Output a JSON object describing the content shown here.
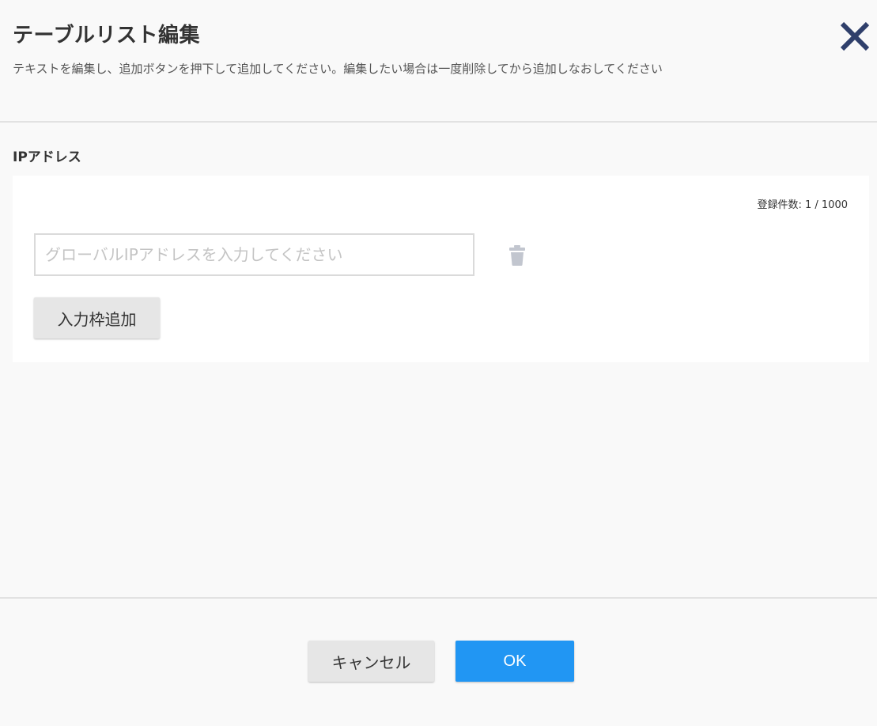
{
  "dialog": {
    "title": "テーブルリスト編集",
    "description": "テキストを編集し、追加ボタンを押下して追加してください。編集したい場合は一度削除してから追加しなおしてください",
    "close_icon": "close-icon"
  },
  "section": {
    "label": "IPアドレス",
    "count_label": "登録件数: ",
    "count_current": "1",
    "count_separator": " / ",
    "count_max": "1000",
    "entries": [
      {
        "value": "",
        "placeholder": "グローバルIPアドレスを入力してください",
        "delete_icon": "trash-icon"
      }
    ],
    "add_button_label": "入力枠追加"
  },
  "footer": {
    "cancel_label": "キャンセル",
    "ok_label": "OK"
  },
  "colors": {
    "close_icon": "#2f3f6b",
    "trash_icon": "#c2c6cf",
    "primary": "#2196f3",
    "secondary_button": "#e6e6e6",
    "background": "#f9f9f9"
  }
}
